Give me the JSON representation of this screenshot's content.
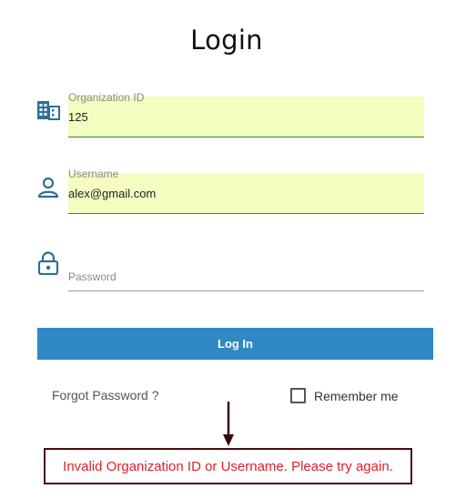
{
  "page": {
    "title": "Login"
  },
  "form": {
    "organization": {
      "label": "Organization ID",
      "value": "125",
      "icon": "building-icon"
    },
    "username": {
      "label": "Username",
      "value": "alex@gmail.com",
      "icon": "user-icon"
    },
    "password": {
      "label": "Password",
      "value": "",
      "icon": "lock-icon"
    },
    "login_button": "Log In",
    "forgot_password": "Forgot Password ?",
    "remember_me": {
      "label": "Remember me",
      "checked": false
    }
  },
  "error": {
    "message": "Invalid Organization ID or Username. Please try again."
  },
  "colors": {
    "accent": "#3089c4",
    "autofill_bg": "#f4fcc0",
    "error_text": "#e0202a",
    "error_border": "#4a0b0b",
    "icon": "#2f6f95"
  }
}
